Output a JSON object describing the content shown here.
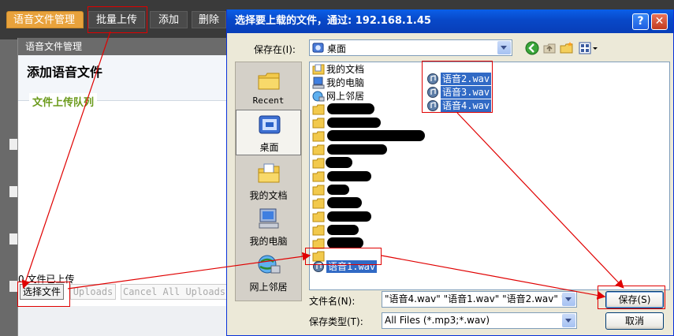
{
  "app": {
    "toolbar": {
      "tab_label": "语音文件管理",
      "batch_upload_label": "批量上传",
      "add_label": "添加",
      "delete_label": "删除"
    },
    "panel": {
      "title": "语音文件管理",
      "heading": "添加语音文件",
      "queue_label": "文件上传队列",
      "uploaded_status": "0 文件已上传",
      "choose_files_label": "选择文件",
      "uploads_label": "Uploads",
      "cancel_all_label": "Cancel All Uploads"
    }
  },
  "dialog": {
    "title": "选择要上载的文件，通过: 192.168.1.45",
    "help_label": "?",
    "close_label": "✕",
    "save_in_label": "保存在(I):",
    "save_in_value": "桌面",
    "places": [
      {
        "label": "Recent",
        "icon": "recent-folder-icon"
      },
      {
        "label": "桌面",
        "icon": "desktop-icon"
      },
      {
        "label": "我的文档",
        "icon": "my-documents-icon"
      },
      {
        "label": "我的电脑",
        "icon": "my-computer-icon"
      },
      {
        "label": "网上邻居",
        "icon": "network-icon"
      }
    ],
    "files": {
      "my_documents": "我的文档",
      "my_computer": "我的电脑",
      "network": "网上邻居",
      "voice1": "语音1.wav",
      "voice2": "语音2.wav",
      "voice3": "语音3.wav",
      "voice4": "语音4.wav"
    },
    "filename_label": "文件名(N):",
    "filename_value": "\"语音4.wav\" \"语音1.wav\" \"语音2.wav\" \"i",
    "filetype_label": "保存类型(T):",
    "filetype_value": "All Files (*.mp3;*.wav)",
    "save_label": "保存(S)",
    "cancel_label": "取消"
  },
  "colors": {
    "annotation": "#e00000",
    "selection": "#316ac5",
    "xp_title": "#0848c8",
    "queue_label": "#6a9a1a"
  }
}
